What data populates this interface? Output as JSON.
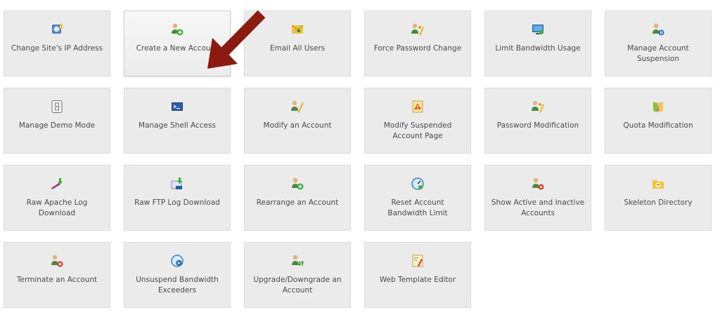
{
  "tiles": [
    {
      "label": "Change Site's IP Address",
      "icon": "ip-address-icon"
    },
    {
      "label": "Create a New Account",
      "icon": "add-user-icon"
    },
    {
      "label": "Email All Users",
      "icon": "email-users-icon"
    },
    {
      "label": "Force Password Change",
      "icon": "password-user-icon"
    },
    {
      "label": "Limit Bandwidth Usage",
      "icon": "bandwidth-icon"
    },
    {
      "label": "Manage Account Suspension",
      "icon": "suspend-user-icon"
    },
    {
      "label": "Manage Demo Mode",
      "icon": "demo-mode-icon"
    },
    {
      "label": "Manage Shell Access",
      "icon": "shell-terminal-icon"
    },
    {
      "label": "Modify an Account",
      "icon": "edit-user-icon"
    },
    {
      "label": "Modify Suspended Account Page",
      "icon": "warning-page-icon"
    },
    {
      "label": "Password Modification",
      "icon": "password-user-icon"
    },
    {
      "label": "Quota Modification",
      "icon": "quota-book-icon"
    },
    {
      "label": "Raw Apache Log Download",
      "icon": "apache-download-icon"
    },
    {
      "label": "Raw FTP Log Download",
      "icon": "ftp-download-icon"
    },
    {
      "label": "Rearrange an Account",
      "icon": "rearrange-user-icon"
    },
    {
      "label": "Reset Account Bandwidth Limit",
      "icon": "reset-gauge-icon"
    },
    {
      "label": "Show Active and Inactive Accounts",
      "icon": "active-users-icon"
    },
    {
      "label": "Skeleton Directory",
      "icon": "skeleton-folder-icon"
    },
    {
      "label": "Terminate an Account",
      "icon": "terminate-user-icon"
    },
    {
      "label": "Unsuspend Bandwidth Exceeders",
      "icon": "unsuspend-gauge-icon"
    },
    {
      "label": "Upgrade/Downgrade an Account",
      "icon": "upgrade-user-icon"
    },
    {
      "label": "Web Template Editor",
      "icon": "template-editor-icon"
    }
  ],
  "highlighted_tile": "Create a New Account",
  "colors": {
    "tile_bg": "#ebebeb",
    "tile_border": "#dcdcdc",
    "label_text": "#4a4a4a",
    "arrow": "#8b1a10"
  }
}
